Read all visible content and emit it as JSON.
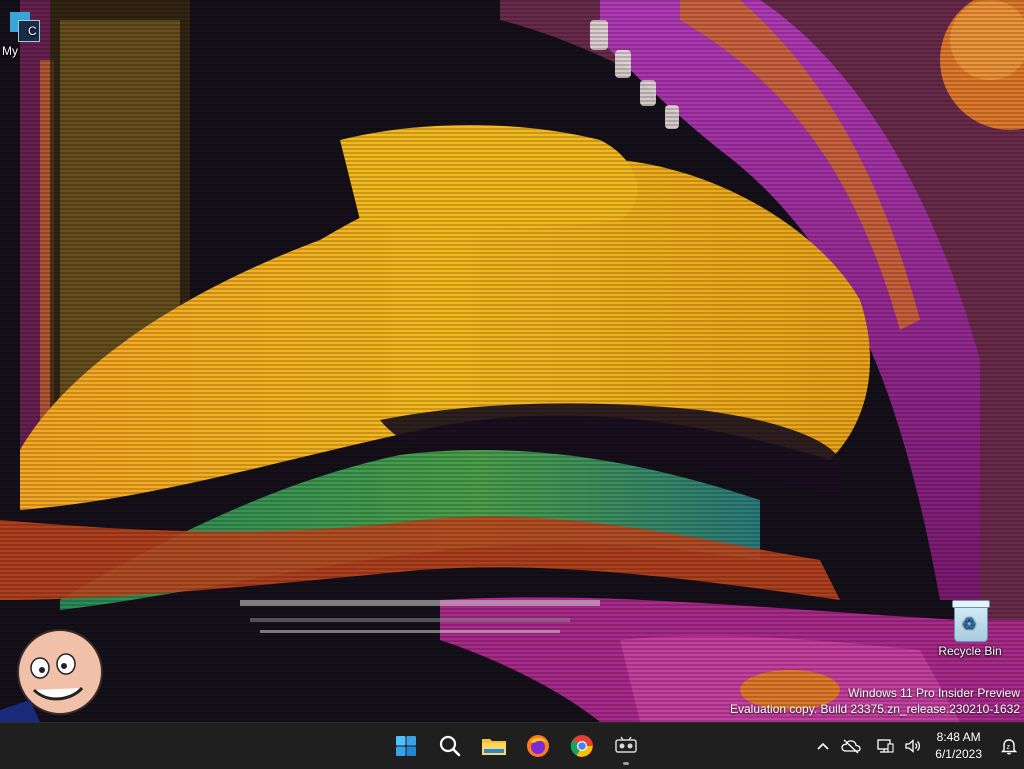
{
  "desktop": {
    "icons": [
      {
        "label": "My",
        "glyph_letter": "C",
        "icon": "app-shortcut-icon"
      },
      {
        "label": "Recycle Bin",
        "icon": "recycle-bin-icon"
      }
    ],
    "watermark": {
      "line1": "Windows 11 Pro Insider Preview",
      "line2": "Evaluation copy. Build 23375.zn_release.230210-1632"
    }
  },
  "taskbar": {
    "apps": [
      {
        "name": "start",
        "icon": "windows-start-icon"
      },
      {
        "name": "search",
        "icon": "search-icon"
      },
      {
        "name": "file-explorer",
        "icon": "folder-icon"
      },
      {
        "name": "firefox",
        "icon": "firefox-icon"
      },
      {
        "name": "chrome",
        "icon": "chrome-icon"
      },
      {
        "name": "app",
        "icon": "generic-app-icon",
        "active": true
      }
    ],
    "tray": {
      "overflow_icon": "chevron-up-icon",
      "onedrive_icon": "cloud-off-icon",
      "network_icon": "network-icon",
      "volume_icon": "volume-icon",
      "time": "8:48 AM",
      "date": "6/1/2023",
      "notification_icon": "notification-icon"
    }
  },
  "colors": {
    "taskbar_bg": "#1f1f1f",
    "accent_blue": "#3aa3d8",
    "wallpaper_yellow": "#f2b21f",
    "wallpaper_magenta": "#c43cc0",
    "wallpaper_green": "#3a9a4a"
  }
}
